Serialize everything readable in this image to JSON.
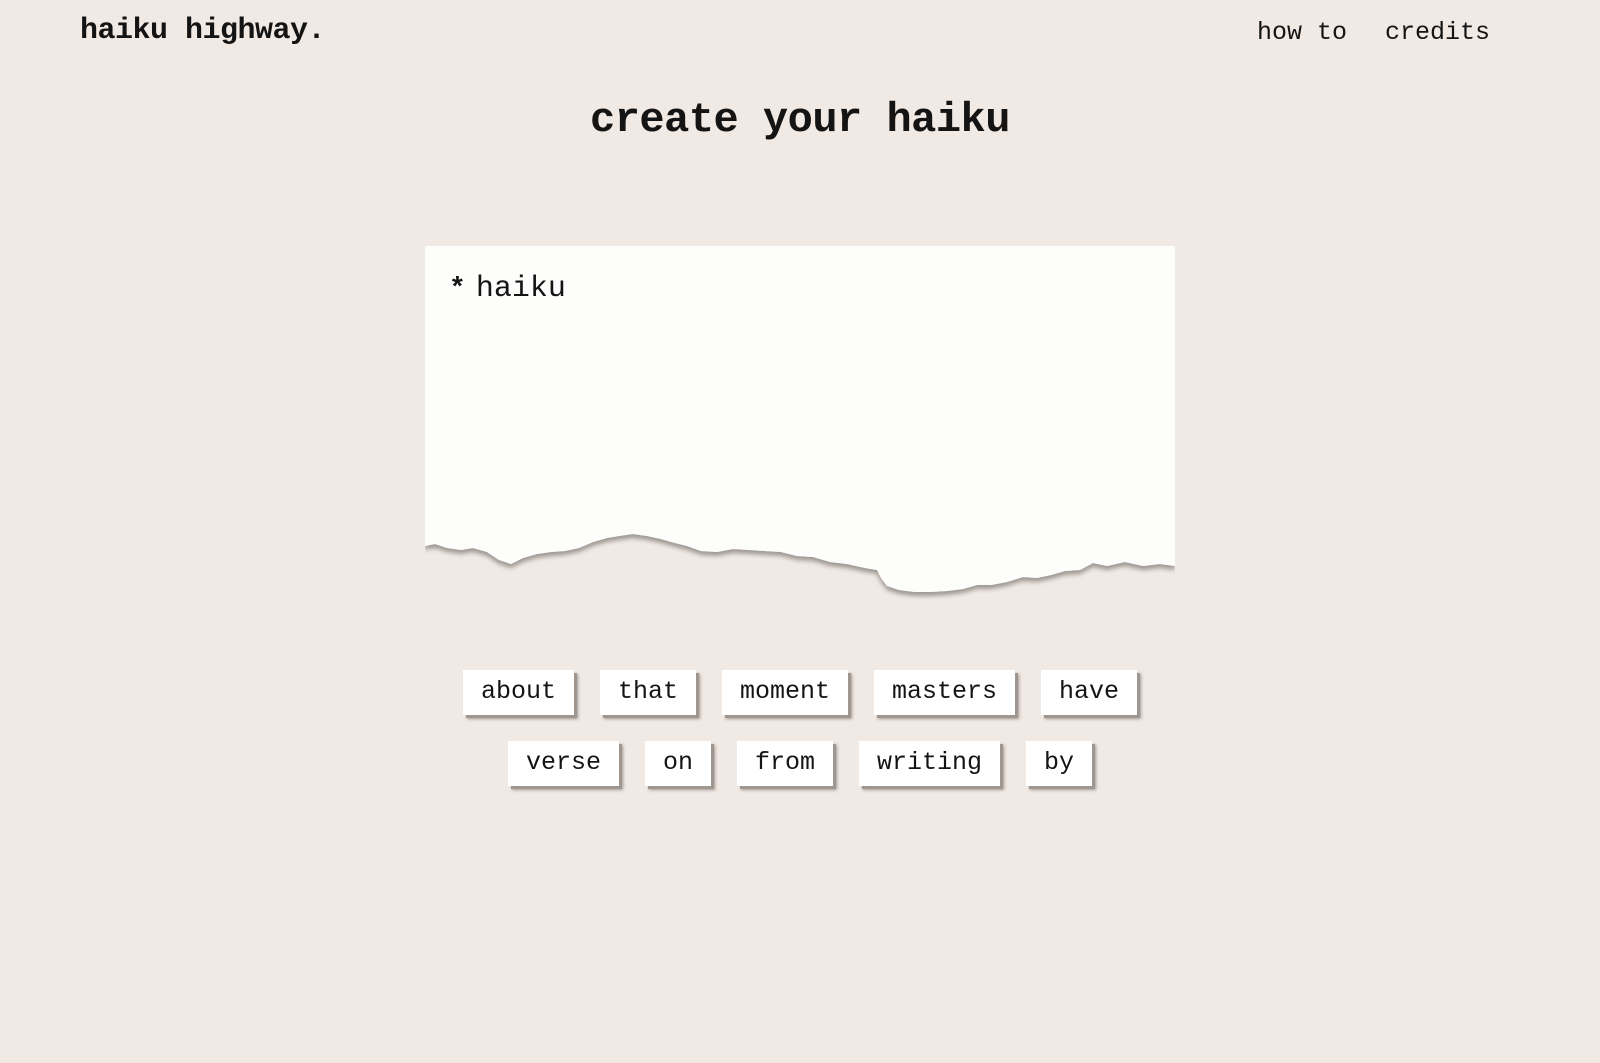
{
  "header": {
    "logo": "haiku highway.",
    "nav": [
      {
        "label": "how to"
      },
      {
        "label": "credits"
      }
    ]
  },
  "main": {
    "title": "create your haiku",
    "paper": {
      "bullet": "*",
      "placeholder": "haiku"
    },
    "word_rows": [
      [
        "about",
        "that",
        "moment",
        "masters",
        "have"
      ],
      [
        "verse",
        "on",
        "from",
        "writing",
        "by"
      ]
    ]
  },
  "colors": {
    "background": "#f1e9e3",
    "paper": "#ffffff",
    "text": "#141414"
  }
}
